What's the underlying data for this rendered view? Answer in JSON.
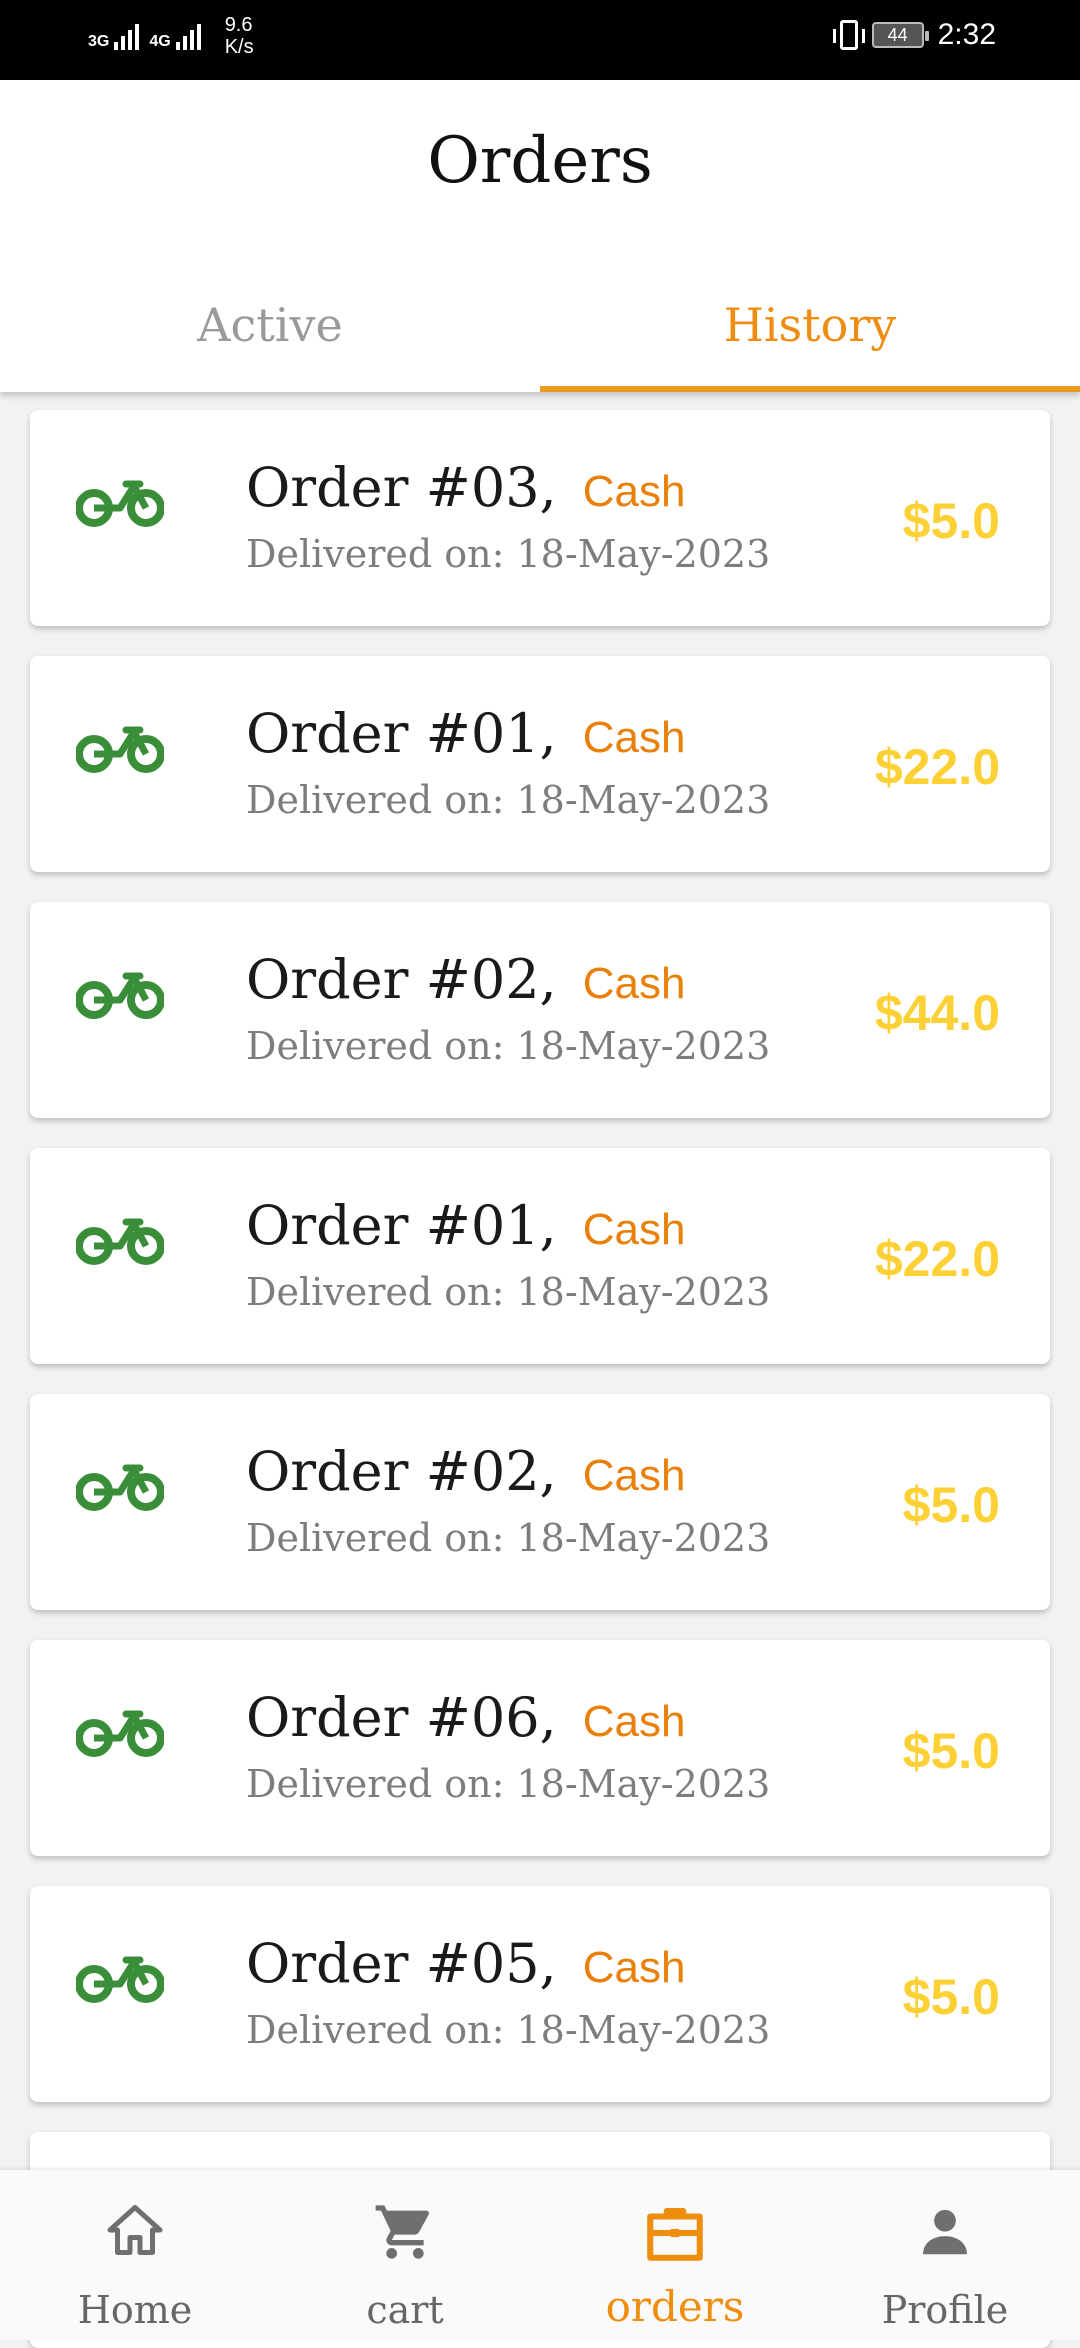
{
  "status_bar": {
    "network_1": "3G",
    "network_2": "4G",
    "speed_value": "9.6",
    "speed_unit": "K/s",
    "battery": "44",
    "time": "2:32"
  },
  "header": {
    "title": "Orders",
    "tabs": [
      {
        "label": "Active",
        "selected": false
      },
      {
        "label": "History",
        "selected": true
      }
    ]
  },
  "orders": [
    {
      "title": "Order #03,",
      "payment": "Cash",
      "delivered": "Delivered on: 18-May-2023",
      "price": "$5.0"
    },
    {
      "title": "Order #01,",
      "payment": "Cash",
      "delivered": "Delivered on: 18-May-2023",
      "price": "$22.0"
    },
    {
      "title": "Order #02,",
      "payment": "Cash",
      "delivered": "Delivered on: 18-May-2023",
      "price": "$44.0"
    },
    {
      "title": "Order #01,",
      "payment": "Cash",
      "delivered": "Delivered on: 18-May-2023",
      "price": "$22.0"
    },
    {
      "title": "Order #02,",
      "payment": "Cash",
      "delivered": "Delivered on: 18-May-2023",
      "price": "$5.0"
    },
    {
      "title": "Order #06,",
      "payment": "Cash",
      "delivered": "Delivered on: 18-May-2023",
      "price": "$5.0"
    },
    {
      "title": "Order #05,",
      "payment": "Cash",
      "delivered": "Delivered on: 18-May-2023",
      "price": "$5.0"
    }
  ],
  "bottom_nav": [
    {
      "label": "Home",
      "icon": "home-icon",
      "selected": false
    },
    {
      "label": "cart",
      "icon": "cart-icon",
      "selected": false
    },
    {
      "label": "orders",
      "icon": "briefcase-icon",
      "selected": true
    },
    {
      "label": "Profile",
      "icon": "person-icon",
      "selected": false
    }
  ],
  "colors": {
    "accent": "#EE8D12",
    "price": "#FDD035",
    "bike_icon": "#3A8E3A",
    "payment": "#E8800A"
  }
}
